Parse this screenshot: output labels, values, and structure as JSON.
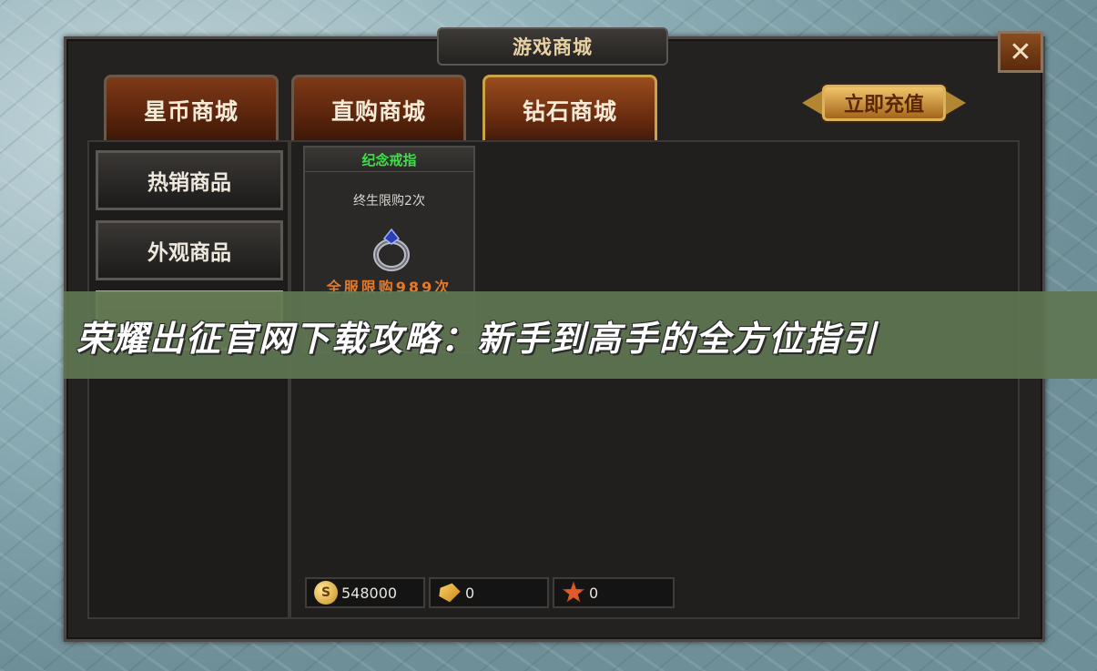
{
  "window": {
    "title": "游戏商城",
    "close_label": "✕"
  },
  "tabs": [
    {
      "label": "星币商城",
      "active": false
    },
    {
      "label": "直购商城",
      "active": false
    },
    {
      "label": "钻石商城",
      "active": true
    }
  ],
  "recharge_label": "立即充值",
  "sidebar": {
    "items": [
      {
        "label": "热销商品"
      },
      {
        "label": "外观商品"
      }
    ]
  },
  "item": {
    "name": "纪念戒指",
    "limit": "终生限购2次",
    "server_limit": "全服限购989次",
    "icon": "ring-icon"
  },
  "banner": {
    "text": "荣耀出征官网下载攻略：新手到高手的全方位指引"
  },
  "currencies": [
    {
      "icon": "coin-icon",
      "glyph": "S",
      "value": "548000"
    },
    {
      "icon": "gold-ingot-icon",
      "glyph": "",
      "value": "0"
    },
    {
      "icon": "medal-icon",
      "glyph": "",
      "value": "0"
    }
  ],
  "colors": {
    "item_name": "#3ee04a",
    "server_limit": "#e47a2a",
    "banner_bg": "#607652"
  }
}
